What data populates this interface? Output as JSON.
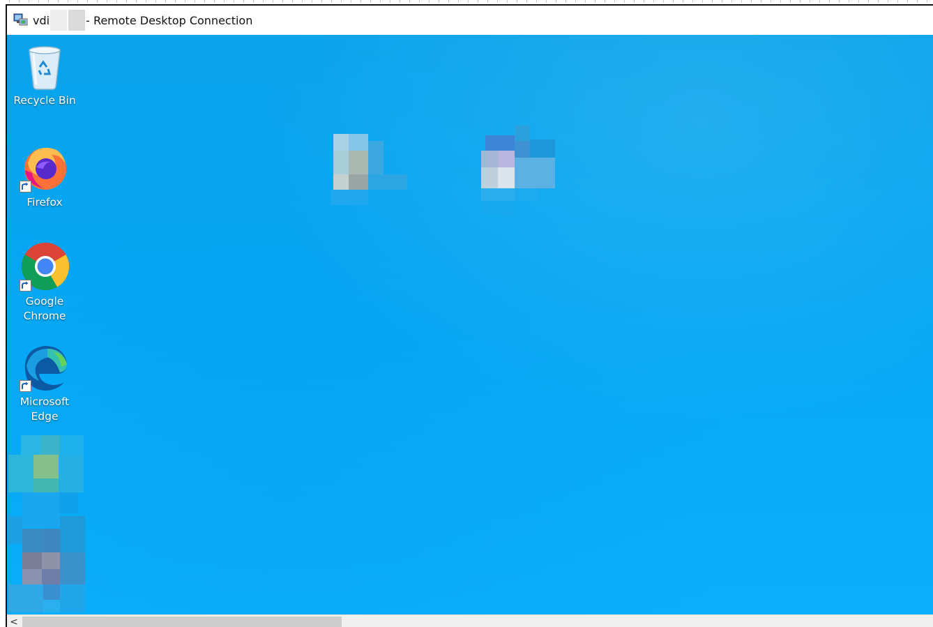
{
  "window": {
    "title_prefix": "vdi",
    "title_suffix": "- Remote Desktop Connection"
  },
  "desktop": {
    "icons": [
      {
        "label": "Recycle Bin",
        "icon": "recycle-bin-icon"
      },
      {
        "label": "Firefox",
        "icon": "firefox-icon"
      },
      {
        "label": "Google\nChrome",
        "icon": "chrome-icon"
      },
      {
        "label": "Microsoft\nEdge",
        "icon": "edge-icon"
      }
    ],
    "background_color": "#06a8f4"
  },
  "scrollbar": {
    "left_arrow": "<"
  }
}
